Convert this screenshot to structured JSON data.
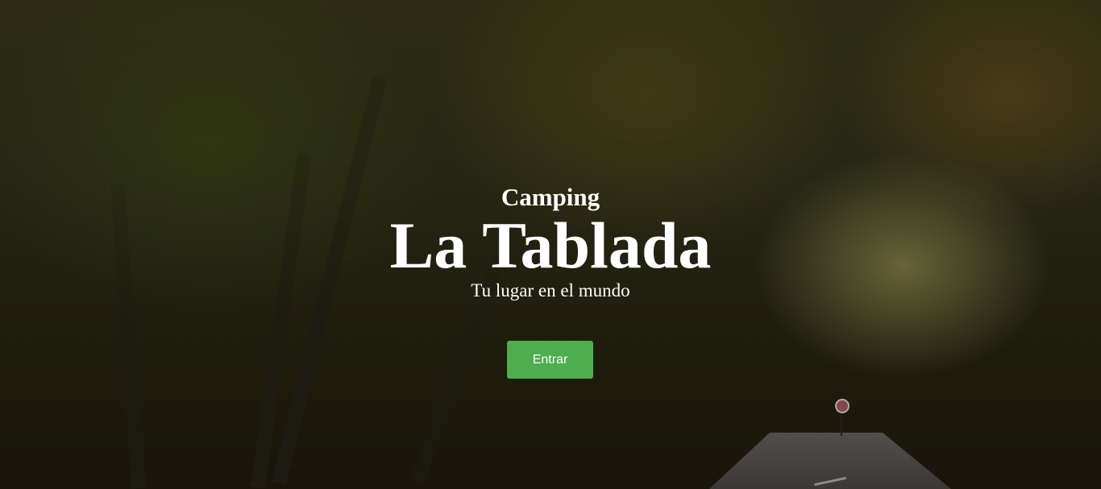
{
  "hero": {
    "subtitle": "Camping",
    "title": "La Tablada",
    "tagline": "Tu lugar en el mundo",
    "button_label": "Entrar"
  },
  "colors": {
    "button_background": "#4cae4f",
    "text": "#ffffff"
  }
}
